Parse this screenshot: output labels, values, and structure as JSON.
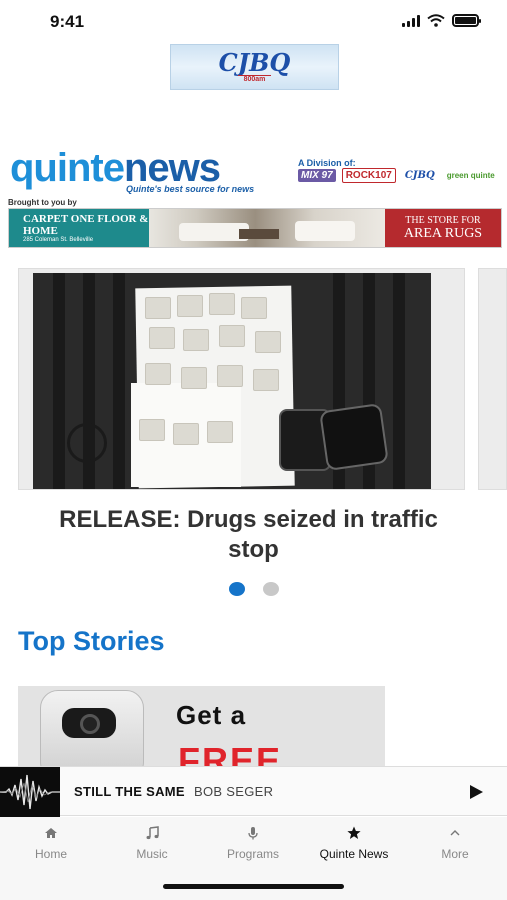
{
  "status_bar": {
    "time": "9:41"
  },
  "sponsor_logo": {
    "name": "CJBQ",
    "sub": "800am"
  },
  "header": {
    "logo_part1": "quinte",
    "logo_part2": "news",
    "tagline": "Quinte's best source for news",
    "division_label": "A Division of:",
    "stations": [
      "MIX 97",
      "ROCK107",
      "CJBQ",
      "green quinte"
    ],
    "brought_by": "Brought to you by"
  },
  "ad_banner": {
    "left_title": "CARPET ONE FLOOR & HOME",
    "left_address": "285 Coleman St. Belleville",
    "right_line1": "THE STORE FOR",
    "right_line2": "AREA RUGS"
  },
  "carousel": {
    "headline_line1": "RELEASE: Drugs seized in traffic",
    "headline_line2": "stop",
    "page_count": 2,
    "active_index": 0
  },
  "top_stories": {
    "title": "Top Stories",
    "card": {
      "promo_line1": "Get a",
      "promo_line2": "FREE"
    }
  },
  "now_playing": {
    "title": "STILL THE SAME",
    "artist": "BOB SEGER"
  },
  "tabs": [
    {
      "label": "Home",
      "icon": "home-icon"
    },
    {
      "label": "Music",
      "icon": "music-note-icon"
    },
    {
      "label": "Programs",
      "icon": "microphone-icon"
    },
    {
      "label": "Quinte News",
      "icon": "star-icon",
      "active": true
    },
    {
      "label": "More",
      "icon": "chevron-up-icon"
    }
  ],
  "colors": {
    "accent": "#1574c9",
    "brand_light": "#1e8fd8",
    "brand_dark": "#1b5fa8",
    "promo_red": "#e0242b"
  }
}
